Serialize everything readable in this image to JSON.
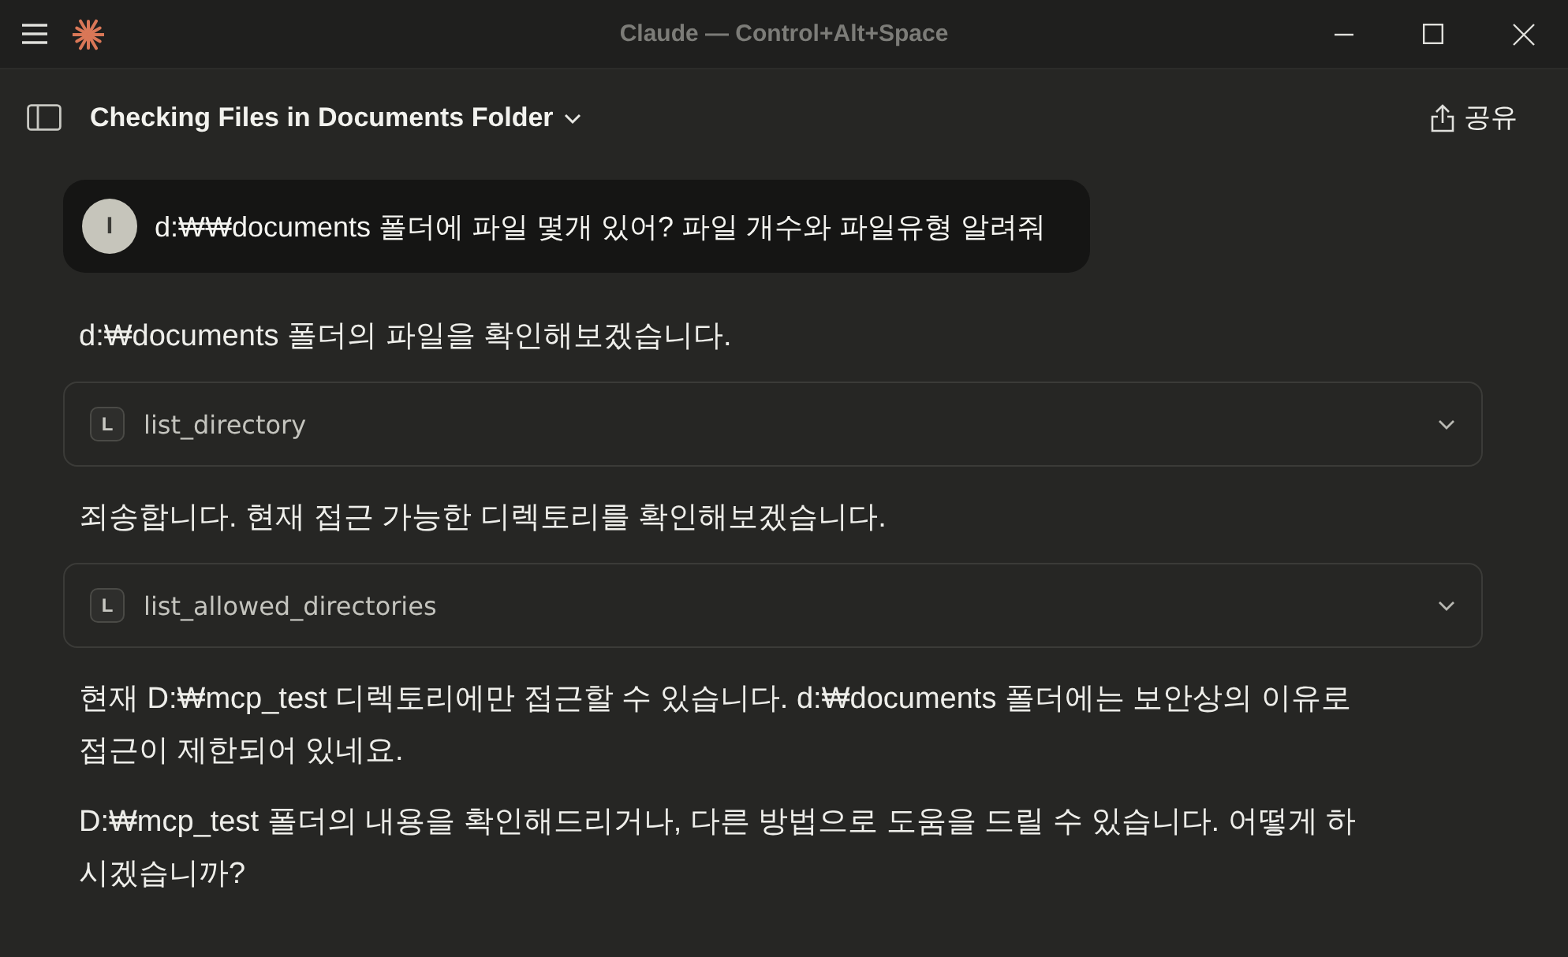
{
  "window": {
    "title": "Claude — Control+Alt+Space"
  },
  "header": {
    "title": "Checking Files in Documents Folder",
    "share_label": "공유"
  },
  "messages": [
    {
      "kind": "user",
      "avatar": "I",
      "text": "d:₩₩documents 폴더에 파일 몇개 있어? 파일 개수와 파일유형 알려줘"
    },
    {
      "kind": "text",
      "text": "d:₩documents 폴더의 파일을 확인해보겠습니다."
    },
    {
      "kind": "tool",
      "icon": "L",
      "name": "list_directory",
      "expanded": false
    },
    {
      "kind": "text",
      "text": "죄송합니다. 현재 접근 가능한 디렉토리를 확인해보겠습니다."
    },
    {
      "kind": "tool",
      "icon": "L",
      "name": "list_allowed_directories",
      "expanded": false
    },
    {
      "kind": "text",
      "text": "현재 D:₩mcp_test 디렉토리에만 접근할 수 있습니다. d:₩documents 폴더에는 보안상의 이유로 접근이 제한되어 있네요."
    },
    {
      "kind": "text",
      "text": "D:₩mcp_test 폴더의 내용을 확인해드리거나, 다른 방법으로 도움을 드릴 수 있습니다. 어떻게 하시겠습니까?"
    }
  ]
}
